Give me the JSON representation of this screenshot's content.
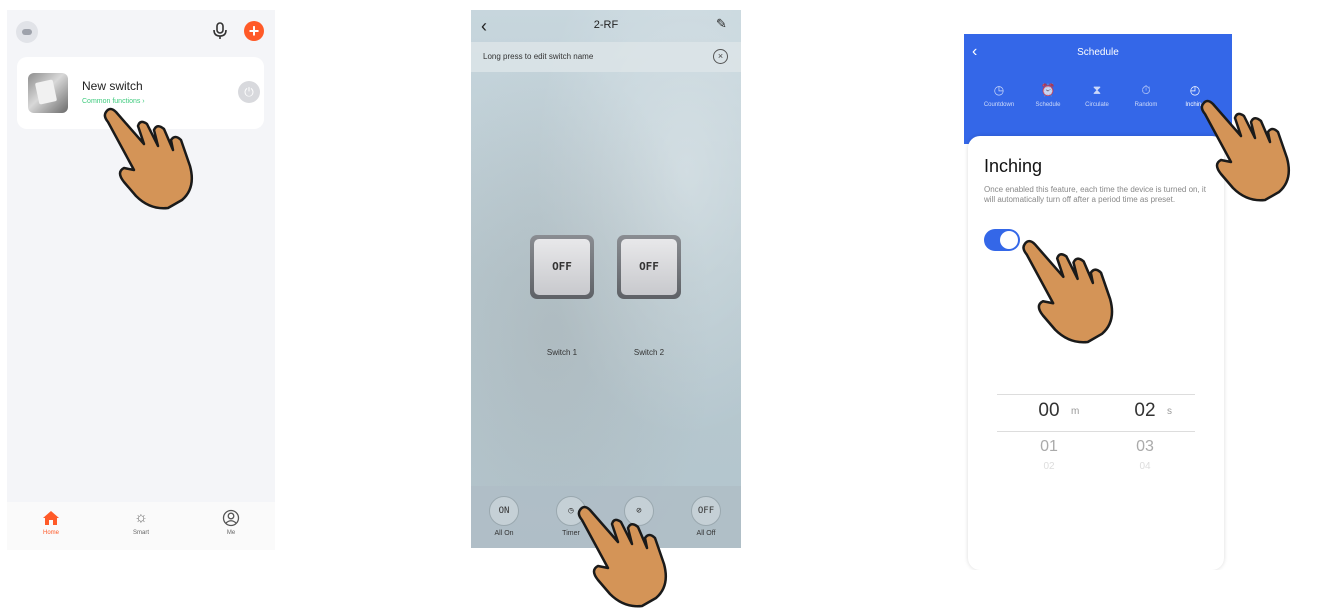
{
  "screen1": {
    "device_name": "New switch",
    "device_subtitle": "Common functions ›",
    "tabs": [
      {
        "label": "Home",
        "icon": "home-icon"
      },
      {
        "label": "Smart",
        "icon": "sun-icon"
      },
      {
        "label": "Me",
        "icon": "user-icon"
      }
    ],
    "colors": {
      "accent": "#ff5a28",
      "subtitle_green": "#3fcb7e"
    }
  },
  "screen2": {
    "title": "2-RF",
    "hint": "Long press to edit switch name",
    "switches": [
      {
        "state": "OFF",
        "label": "Switch 1"
      },
      {
        "state": "OFF",
        "label": "Switch 2"
      }
    ],
    "bottom_buttons": [
      {
        "glyph": "ON",
        "label": "All On"
      },
      {
        "glyph": "◷",
        "label": "Timer"
      },
      {
        "glyph": "⊘",
        "label": ""
      },
      {
        "glyph": "OFF",
        "label": "All Off"
      }
    ]
  },
  "screen3": {
    "title": "Schedule",
    "modes": [
      {
        "label": "Countdown",
        "icon": "clock-icon"
      },
      {
        "label": "Schedule",
        "icon": "alarm-icon"
      },
      {
        "label": "Circulate",
        "icon": "hourglass-icon"
      },
      {
        "label": "Random",
        "icon": "stopwatch-icon"
      },
      {
        "label": "Inching",
        "icon": "timer-icon"
      }
    ],
    "panel_title": "Inching",
    "panel_description": "Once enabled this feature,  each time the device is turned on, it will automatically turn off after a period time as preset.",
    "toggle_on": true,
    "picker": {
      "minutes": [
        "00",
        "01",
        "02"
      ],
      "seconds": [
        "02",
        "03",
        "04"
      ],
      "minute_unit": "m",
      "second_unit": "s"
    },
    "colors": {
      "primary": "#3467e8"
    }
  }
}
